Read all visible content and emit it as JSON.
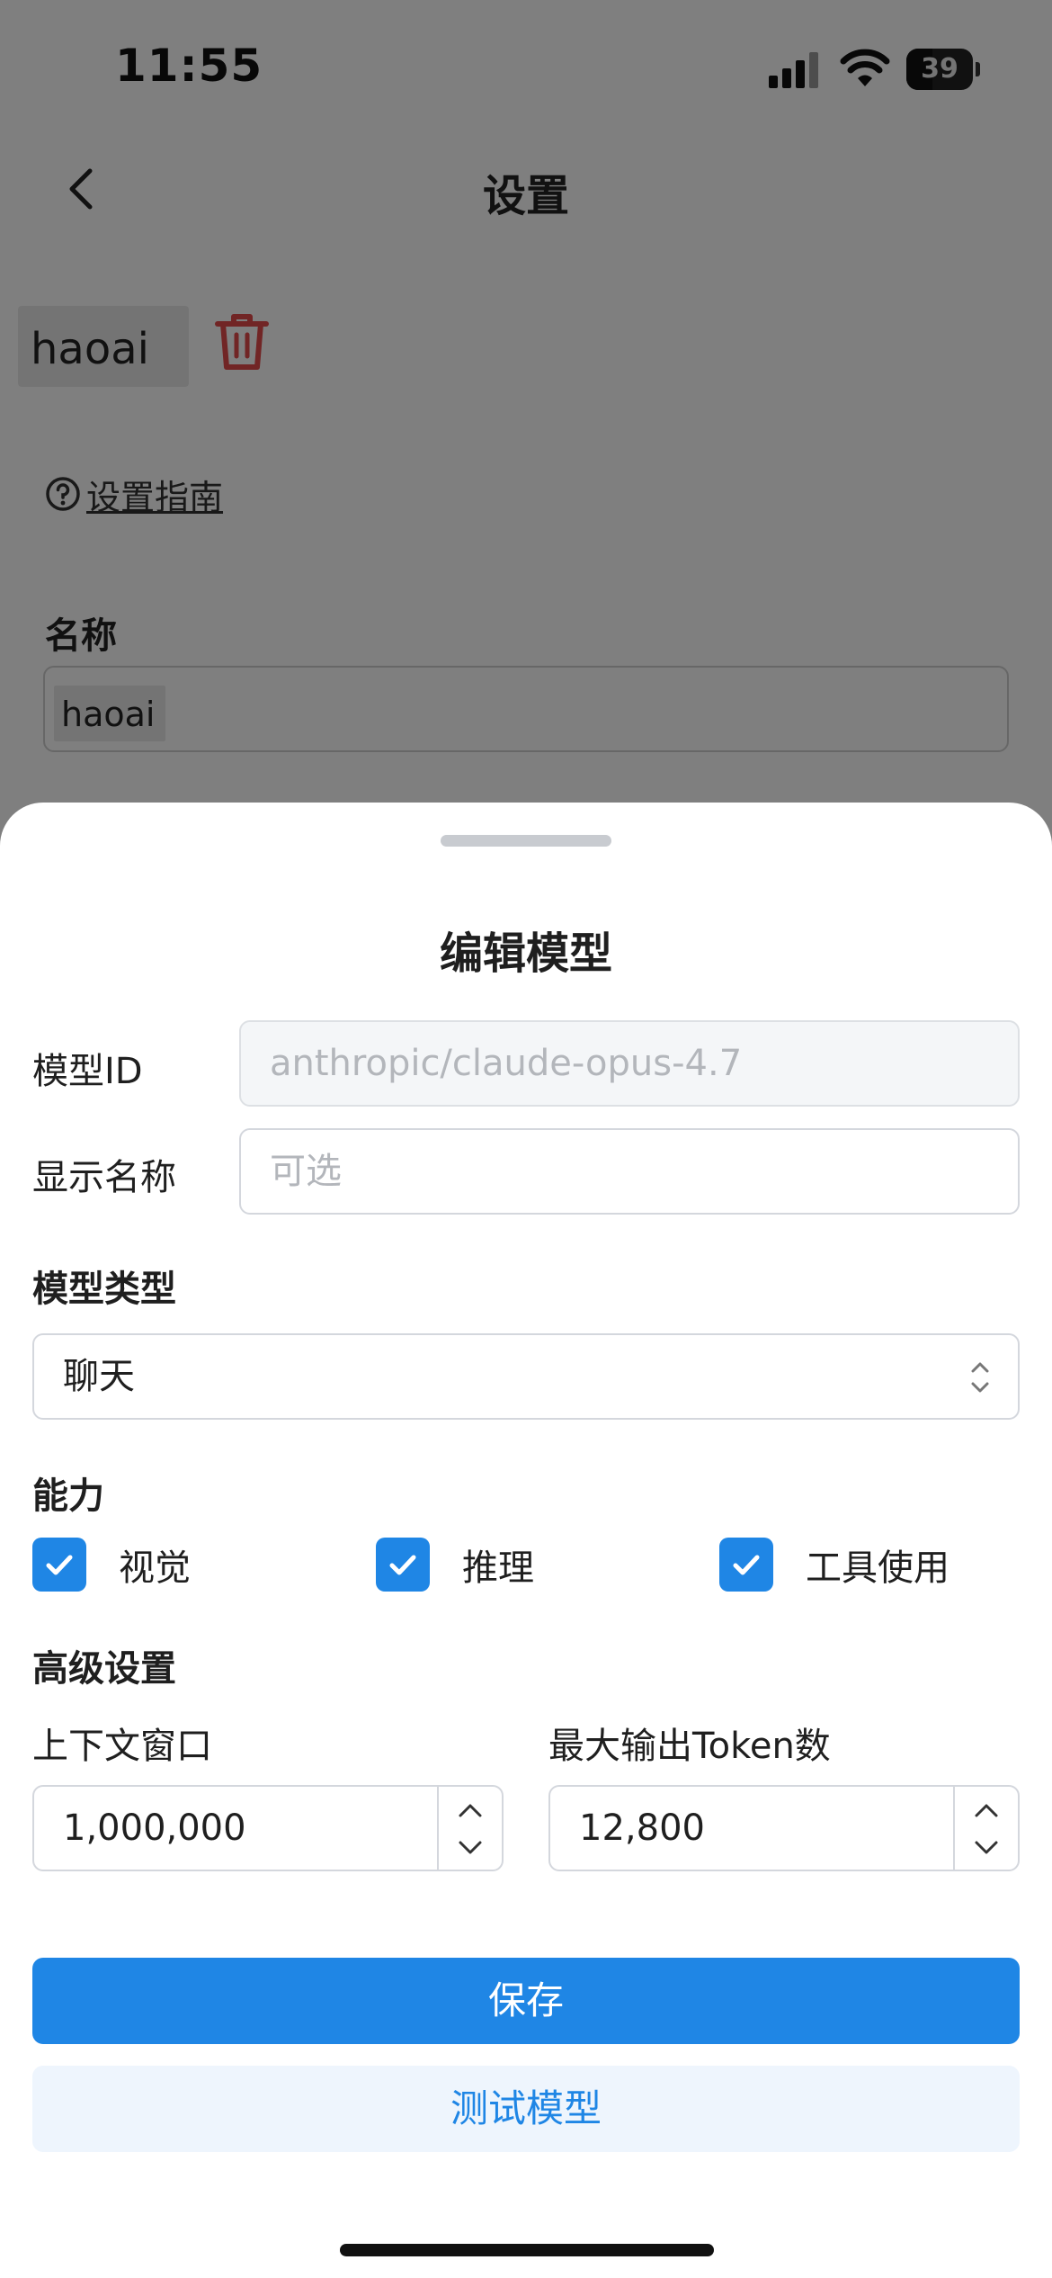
{
  "status_bar": {
    "time": "11:55",
    "battery_level": "39",
    "battery_fraction": 0.39
  },
  "background": {
    "title": "设置",
    "provider_name": "haoai",
    "guide_link": "设置指南",
    "name_label": "名称",
    "name_value": "haoai"
  },
  "sheet": {
    "title": "编辑模型",
    "model_id": {
      "label": "模型ID",
      "value": "anthropic/claude-opus-4.7"
    },
    "display_name": {
      "label": "显示名称",
      "placeholder": "可选"
    },
    "model_type": {
      "label": "模型类型",
      "selected": "聊天"
    },
    "capabilities": {
      "label": "能力",
      "items": [
        {
          "label": "视觉",
          "checked": true
        },
        {
          "label": "推理",
          "checked": true
        },
        {
          "label": "工具使用",
          "checked": true
        }
      ]
    },
    "advanced": {
      "label": "高级设置",
      "context_window": {
        "label": "上下文窗口",
        "value": "1,000,000"
      },
      "max_output_tokens": {
        "label": "最大输出Token数",
        "value": "12,800"
      }
    },
    "save_label": "保存",
    "test_label": "测试模型"
  },
  "colors": {
    "accent": "#1f86e5",
    "danger": "#e34b4b",
    "test_bg": "#eef5fd"
  },
  "icons": [
    "back-icon",
    "trash-icon",
    "help-icon",
    "chevron-updown-icon",
    "check-icon",
    "chevron-up-icon",
    "chevron-down-icon",
    "signal-icon",
    "wifi-icon",
    "battery-icon"
  ]
}
